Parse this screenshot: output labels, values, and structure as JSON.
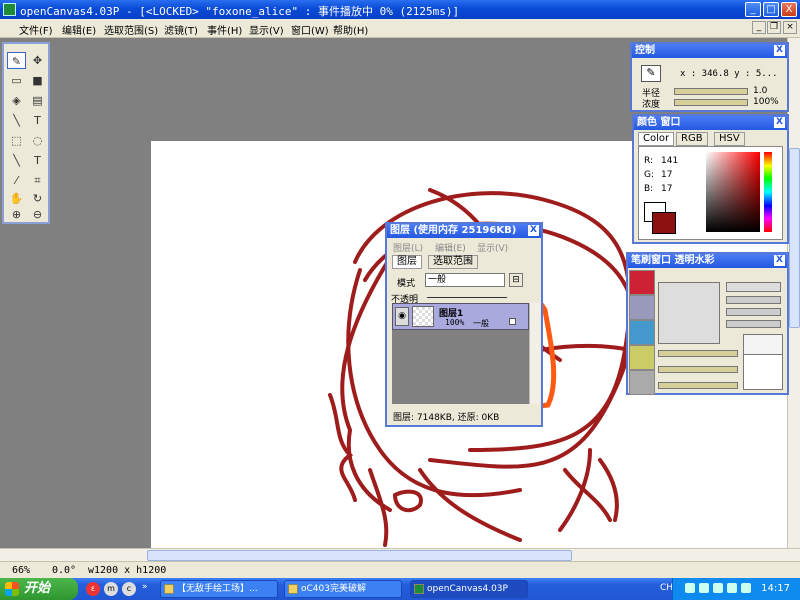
{
  "window": {
    "title": "openCanvas4.03P  - [<LOCKED> \"foxone_alice\" : 事件播放中 0% (2125ms)]",
    "min_label": "_",
    "max_label": "□",
    "close_label": "X"
  },
  "menu": [
    "文件(F)",
    "编辑(E)",
    "选取范围(S)",
    "滤镜(T)",
    "事件(H)",
    "显示(V)",
    "窗口(W)",
    "帮助(H)"
  ],
  "control_panel": {
    "title": "控制",
    "coords": "x : 346.8   y : 5...",
    "radius_label": "半径",
    "radius_value": "1.0",
    "density_label": "浓度",
    "density_value": "100%",
    "close_label": "X"
  },
  "color_panel": {
    "title": "颜色 窗口",
    "tabs": [
      "Color",
      "RGB",
      "HSV"
    ],
    "r_label": "R:",
    "r_value": "141",
    "g_label": "G:",
    "g_value": "17",
    "b_label": "B:",
    "b_value": "17",
    "current_color": "#8d1111",
    "close_label": "X"
  },
  "brush_panel": {
    "title": "笔刷窗口   透明水彩",
    "close_label": "X"
  },
  "layer_panel": {
    "title": "图层 (使用内存 25196KB)",
    "menu": [
      "图层(L)",
      "编辑(E)",
      "显示(V)"
    ],
    "tabs": [
      "图层",
      "选取范围"
    ],
    "mode_label": "模式",
    "mode_value": "一般",
    "opacity_label": "不透明",
    "layer_name": "图层1",
    "layer_opacity": "100%",
    "layer_mode": "一般",
    "footer": "图层: 7148KB, 还原: 0KB",
    "close_label": "X"
  },
  "status": {
    "zoom": "66%",
    "rotation": "0.0°",
    "size": "w1200 x h1200"
  },
  "taskbar": {
    "start_label": "开始",
    "tasks": [
      "【无敌手绘工场】...",
      "oC403完美破解",
      "openCanvas4.03P"
    ],
    "lang": "CH",
    "clock": "14:17"
  },
  "colors": {
    "stroke": "#9e1c1c",
    "annotation": "#ff5a14",
    "titlebar": "#0a4bd6"
  },
  "icons": {
    "toolbox": [
      "pen-icon",
      "move-icon",
      "eraser-icon",
      "color-swatch-icon",
      "fill-icon",
      "gradient-icon",
      "line-icon",
      "text-icon",
      "rect-select-icon",
      "lasso-select-icon",
      "stroke-icon",
      "text-outline-icon",
      "eyedropper-icon",
      "crop-icon",
      "hand-icon",
      "rotate-hand-icon",
      "zoom-in-icon",
      "zoom-out-icon"
    ]
  }
}
